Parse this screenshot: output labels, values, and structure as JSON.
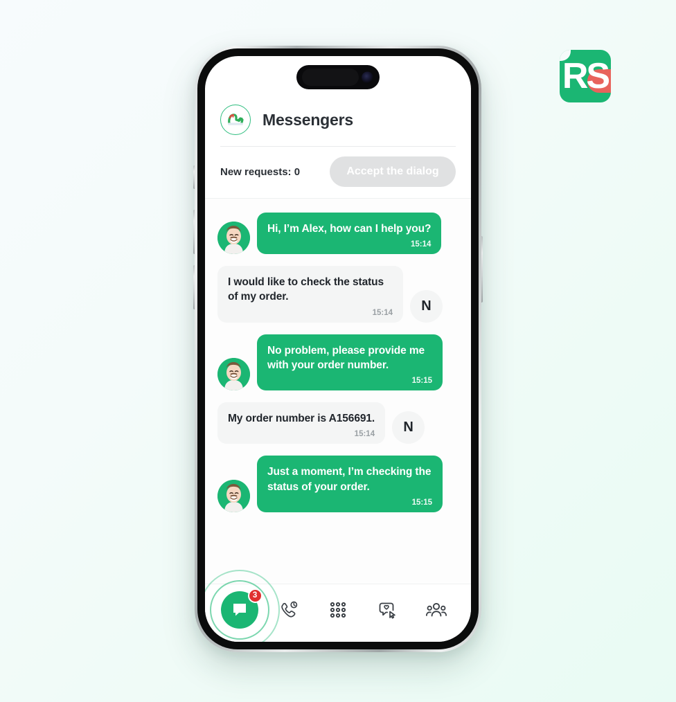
{
  "background": {
    "gradient_from": "#f7fbfd",
    "gradient_to": "#e9fbf4"
  },
  "brand_logo": {
    "name": "rs-logo",
    "letters": "RS",
    "green": "#1BB673",
    "accent_red": "#e8635c"
  },
  "app": {
    "header": {
      "avatar_icon": "dino-brand-avatar",
      "title": "Messengers"
    },
    "requests": {
      "label": "New requests: 0",
      "accept_button": "Accept the dialog",
      "accept_button_enabled": false
    },
    "chat": {
      "accent_green": "#1BB673",
      "client_bubble_bg": "#f4f5f5",
      "messages": [
        {
          "side": "agent",
          "author": "Alex",
          "avatar": "agent-photo",
          "text": "Hi, I’m Alex, how can I help you?",
          "time": "15:14"
        },
        {
          "side": "client",
          "author": "N",
          "avatar": "client-initial",
          "text": "I would like to check the status of my order.",
          "time": "15:14"
        },
        {
          "side": "agent",
          "author": "Alex",
          "avatar": "agent-photo",
          "text": "No problem, please provide me with your order number.",
          "time": "15:15"
        },
        {
          "side": "client",
          "author": "N",
          "avatar": "client-initial",
          "text": "My order number is A156691.",
          "time": "15:14"
        },
        {
          "side": "agent",
          "author": "Alex",
          "avatar": "agent-photo",
          "text": "Just a moment, I’m checking the status of your order.",
          "time": "15:15"
        }
      ]
    },
    "bottom_nav": {
      "items": [
        {
          "icon": "chat-bubble-icon",
          "label": "Chats",
          "active": true,
          "badge": "3"
        },
        {
          "icon": "call-history-icon",
          "label": "Calls",
          "active": false,
          "badge": ""
        },
        {
          "icon": "dialpad-icon",
          "label": "Dialpad",
          "active": false,
          "badge": ""
        },
        {
          "icon": "chat-select-icon",
          "label": "Reviews",
          "active": false,
          "badge": ""
        },
        {
          "icon": "contacts-icon",
          "label": "Contacts",
          "active": false,
          "badge": ""
        }
      ],
      "badge_color": "#e02f2f"
    }
  }
}
